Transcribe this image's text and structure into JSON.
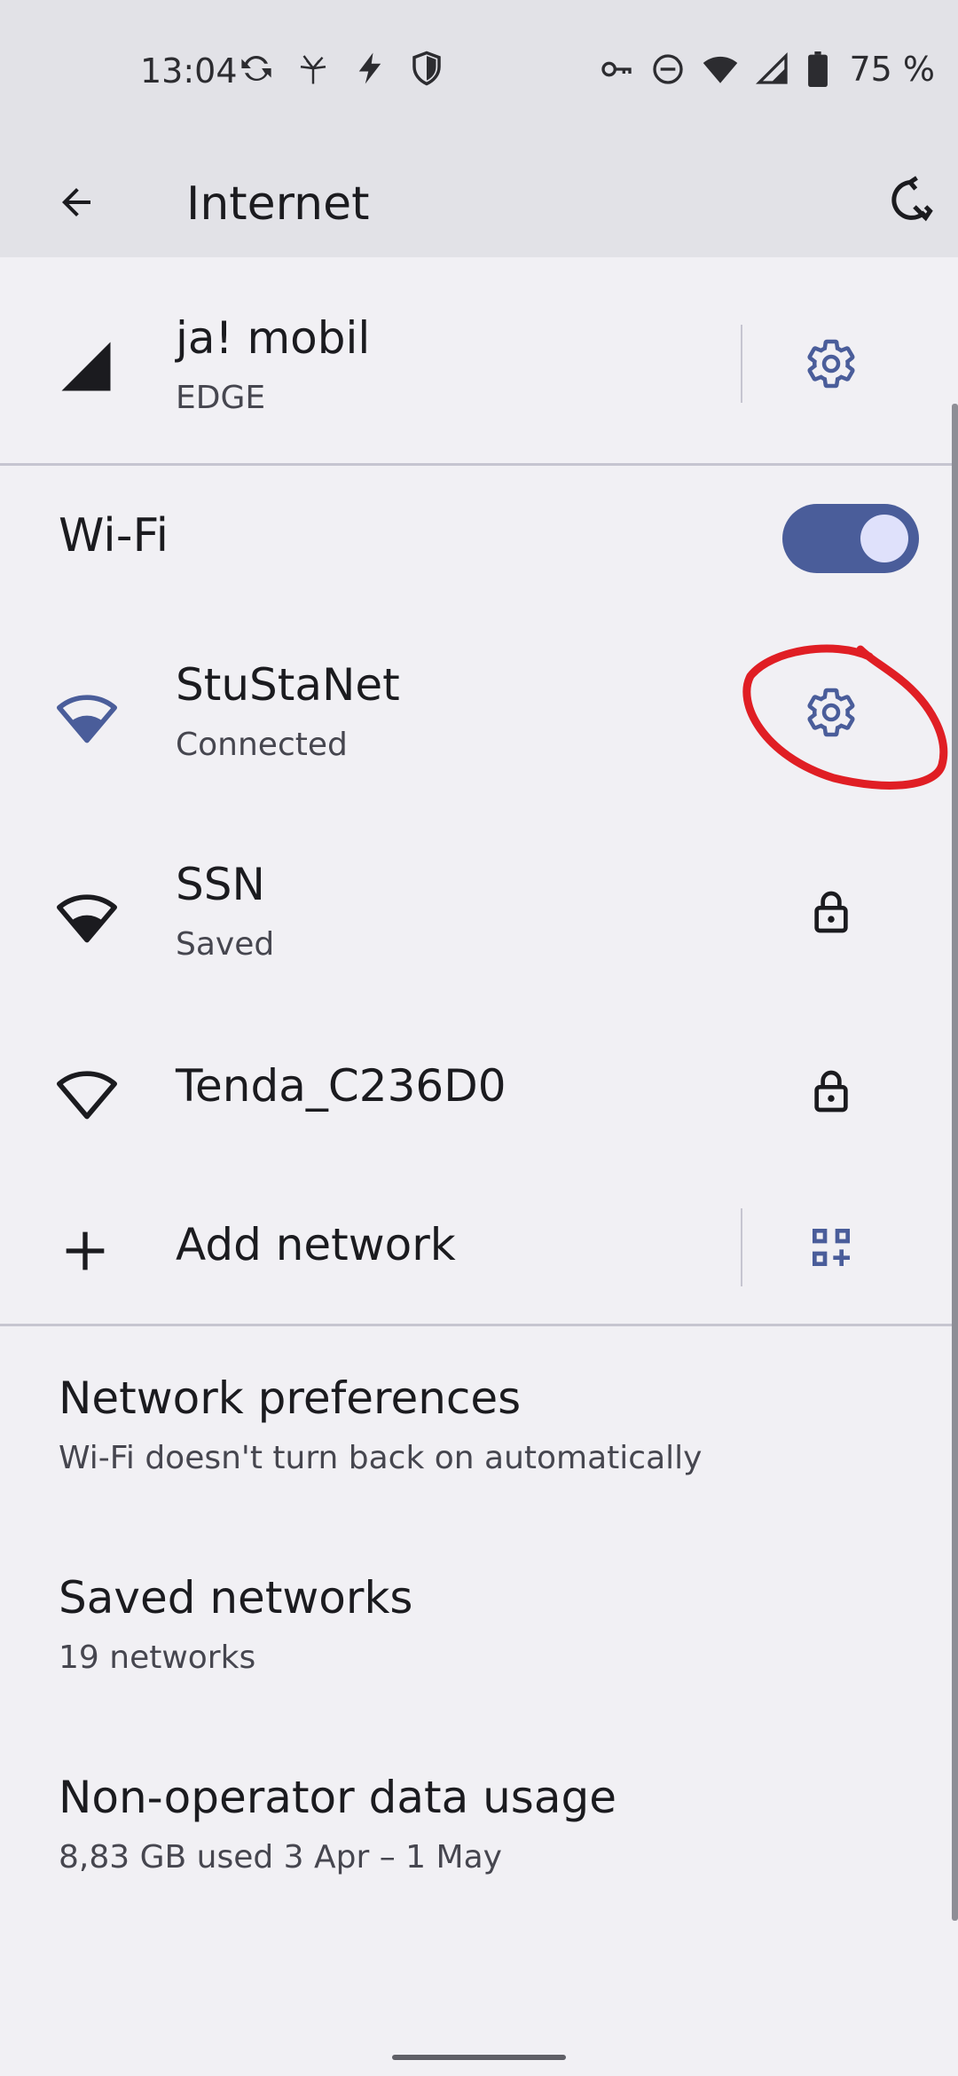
{
  "status_bar": {
    "time": "13:04",
    "battery": "75 %",
    "icons_left": [
      "sync-icon",
      "pinwheel-icon",
      "flash-icon",
      "shield-icon"
    ],
    "icons_right": [
      "vpn-key-icon",
      "do-not-disturb-icon",
      "wifi-icon",
      "cell-signal-icon",
      "battery-icon"
    ]
  },
  "app_bar": {
    "title": "Internet"
  },
  "mobile_network": {
    "name": "ja! mobil",
    "type": "EDGE"
  },
  "wifi": {
    "label": "Wi-Fi",
    "enabled": true,
    "networks": [
      {
        "name": "StuStaNet",
        "status": "Connected",
        "signal": "full",
        "secured": false,
        "action": "settings"
      },
      {
        "name": "SSN",
        "status": "Saved",
        "signal": "full",
        "secured": true,
        "action": "lock"
      },
      {
        "name": "Tenda_C236D0",
        "status": "",
        "signal": "weak",
        "secured": true,
        "action": "lock"
      }
    ]
  },
  "add_network": {
    "label": "Add network"
  },
  "preferences": [
    {
      "title": "Network preferences",
      "subtitle": "Wi-Fi doesn't turn back on automatically"
    },
    {
      "title": "Saved networks",
      "subtitle": "19 networks"
    },
    {
      "title": "Non-operator data usage",
      "subtitle": "8,83 GB used 3 Apr – 1 May"
    }
  ],
  "colors": {
    "accent": "#4a5d9a",
    "background": "#f1f0f4",
    "app_bar": "#e2e2e7",
    "annotation": "#e01e24"
  }
}
